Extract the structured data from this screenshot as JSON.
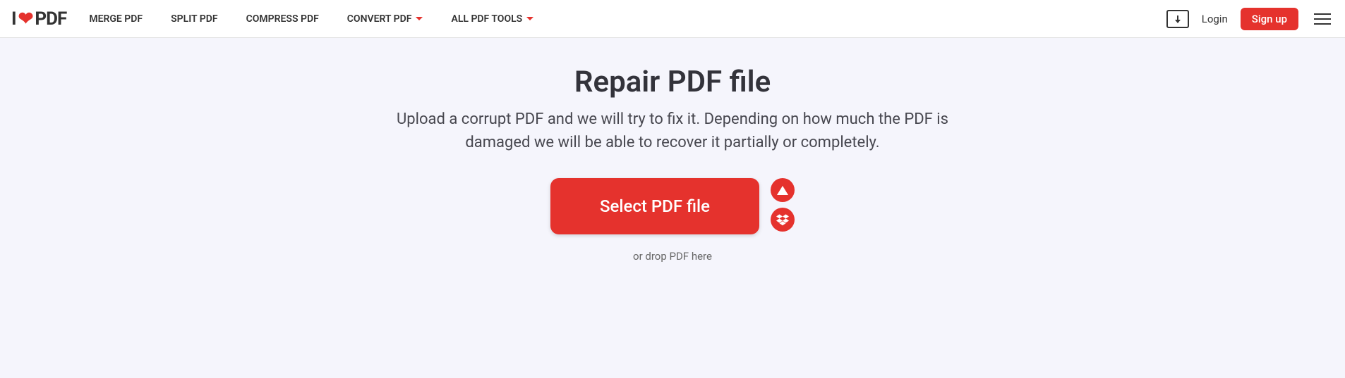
{
  "logo": {
    "i": "I",
    "pdf": "PDF"
  },
  "nav": {
    "merge": "MERGE PDF",
    "split": "SPLIT PDF",
    "compress": "COMPRESS PDF",
    "convert": "CONVERT PDF",
    "alltools": "ALL PDF TOOLS"
  },
  "header": {
    "login": "Login",
    "signup": "Sign up"
  },
  "main": {
    "title": "Repair PDF file",
    "subtitle": "Upload a corrupt PDF and we will try to fix it. Depending on how much the PDF is damaged we will be able to recover it partially or completely.",
    "select_label": "Select PDF file",
    "drop_text": "or drop PDF here"
  }
}
